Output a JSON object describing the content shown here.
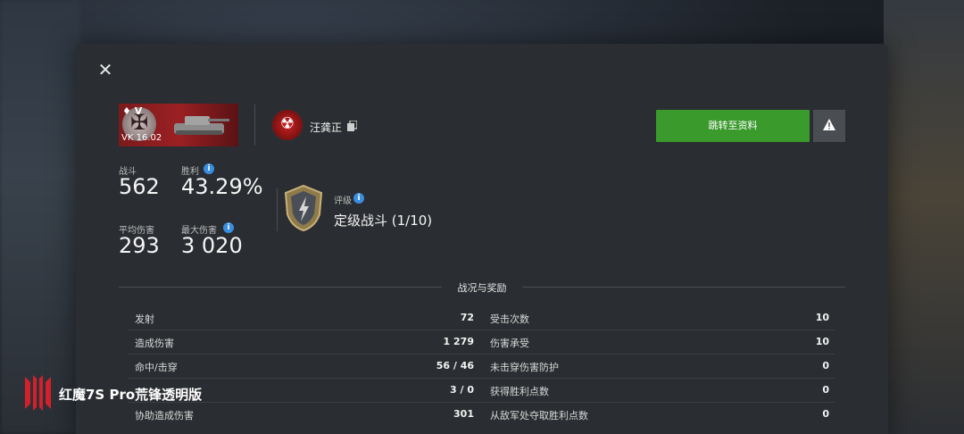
{
  "tank": {
    "tier_label": "V",
    "name": "VK 16.02"
  },
  "player": {
    "name": "汪龚正"
  },
  "buttons": {
    "goto_profile": "跳转至资料"
  },
  "stats": {
    "battles_label": "战斗",
    "battles_value": "562",
    "winrate_label": "胜利",
    "winrate_value": "43.29%",
    "avg_damage_label": "平均伤害",
    "avg_damage_value": "293",
    "max_damage_label": "最大伤害",
    "max_damage_value": "3 020"
  },
  "rank": {
    "label": "评级",
    "value": "定级战斗 (1/10)"
  },
  "section_title": "战况与奖励",
  "left_rows": [
    {
      "label": "发射",
      "value": "72"
    },
    {
      "label": "造成伤害",
      "value": "1 279"
    },
    {
      "label": "命中/击穿",
      "value": "56 / 46"
    },
    {
      "label": "",
      "value": "3 / 0"
    },
    {
      "label": "协助造成伤害",
      "value": "301"
    }
  ],
  "right_rows": [
    {
      "label": "受击次数",
      "value": "10"
    },
    {
      "label": "伤害承受",
      "value": "10"
    },
    {
      "label": "未击穿伤害防护",
      "value": "0"
    },
    {
      "label": "获得胜利点数",
      "value": "0"
    },
    {
      "label": "从敌军处夺取胜利点数",
      "value": "0"
    }
  ],
  "watermark": {
    "text": "红魔7S Pro荒锋透明版"
  },
  "colors": {
    "accent_green": "#3a9a2c",
    "info_blue": "#3a8ee0",
    "tank_red": "#9b2023"
  },
  "icons": {
    "close": "close-icon",
    "copy": "copy-icon",
    "warning": "warning-icon",
    "info": "info-icon"
  }
}
